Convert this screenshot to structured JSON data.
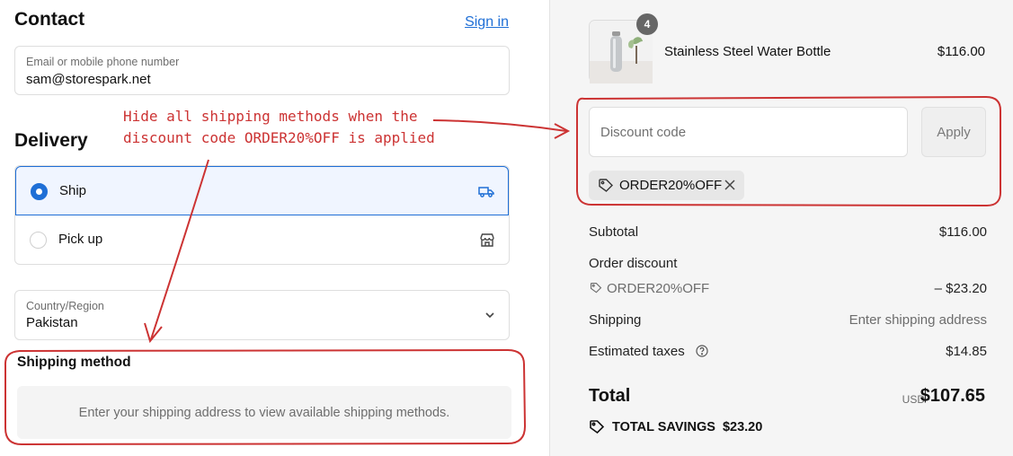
{
  "contact": {
    "title": "Contact",
    "sign_in": "Sign in",
    "field_label": "Email or mobile phone number",
    "field_value": "sam@storespark.net"
  },
  "delivery": {
    "title": "Delivery",
    "options": [
      {
        "label": "Ship",
        "selected": true,
        "icon": "truck-icon"
      },
      {
        "label": "Pick up",
        "selected": false,
        "icon": "store-icon"
      }
    ],
    "country_label": "Country/Region",
    "country_value": "Pakistan"
  },
  "shipping_method": {
    "title": "Shipping method",
    "placeholder": "Enter your shipping address to view available shipping methods."
  },
  "cart": {
    "item_name": "Stainless Steel Water Bottle",
    "item_price": "$116.00",
    "quantity": "4"
  },
  "discount": {
    "placeholder": "Discount code",
    "apply_label": "Apply",
    "applied_code": "ORDER20%OFF"
  },
  "summary": {
    "subtotal_label": "Subtotal",
    "subtotal_value": "$116.00",
    "order_discount_label": "Order discount",
    "discount_code": "ORDER20%OFF",
    "discount_value": "– $23.20",
    "shipping_label": "Shipping",
    "shipping_value": "Enter shipping address",
    "taxes_label": "Estimated taxes",
    "taxes_value": "$14.85",
    "total_label": "Total",
    "currency": "USD",
    "total_value": "$107.65",
    "savings_label": "TOTAL SAVINGS",
    "savings_value": "$23.20"
  },
  "annotation": {
    "line1": "Hide all shipping methods when the",
    "line2": "discount code ORDER20%OFF is applied"
  },
  "colors": {
    "accent": "#1f6fd6",
    "annotation": "#cc3333"
  }
}
